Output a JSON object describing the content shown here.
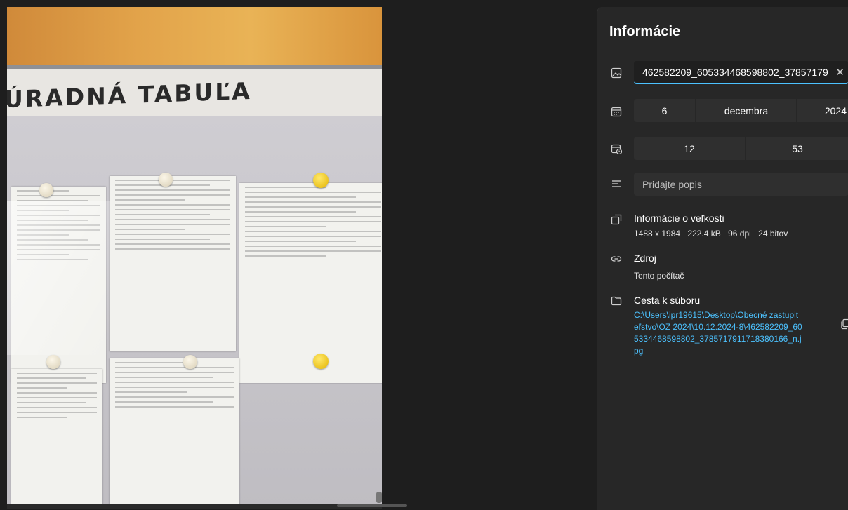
{
  "photo": {
    "board_title": "ÚRADNÁ TABUĽA"
  },
  "panel": {
    "title": "Informácie",
    "file_name": "462582209_605334468598802_37857179",
    "clear_icon": "close-icon",
    "date": {
      "day": "6",
      "month": "decembra",
      "year": "2024"
    },
    "time": {
      "hour": "12",
      "minute": "53"
    },
    "description_placeholder": "Pridajte popis",
    "size_info": {
      "label": "Informácie o veľkosti",
      "dimensions": "1488 x 1984",
      "file_size": "222.4 kB",
      "dpi": "96 dpi",
      "bit_depth": "24 bitov"
    },
    "source": {
      "label": "Zdroj",
      "value": "Tento počítač"
    },
    "path": {
      "label": "Cesta k súboru",
      "value": "C:\\Users\\ipr19615\\Desktop\\Obecné zastupiteľstvo\\OZ 2024\\10.12.2024-8\\462582209_605334468598802_3785717911718380166_n.jpg"
    }
  },
  "colors": {
    "accent": "#4cc2ff",
    "panel_bg": "#272727",
    "app_bg": "#1e1e1e"
  }
}
